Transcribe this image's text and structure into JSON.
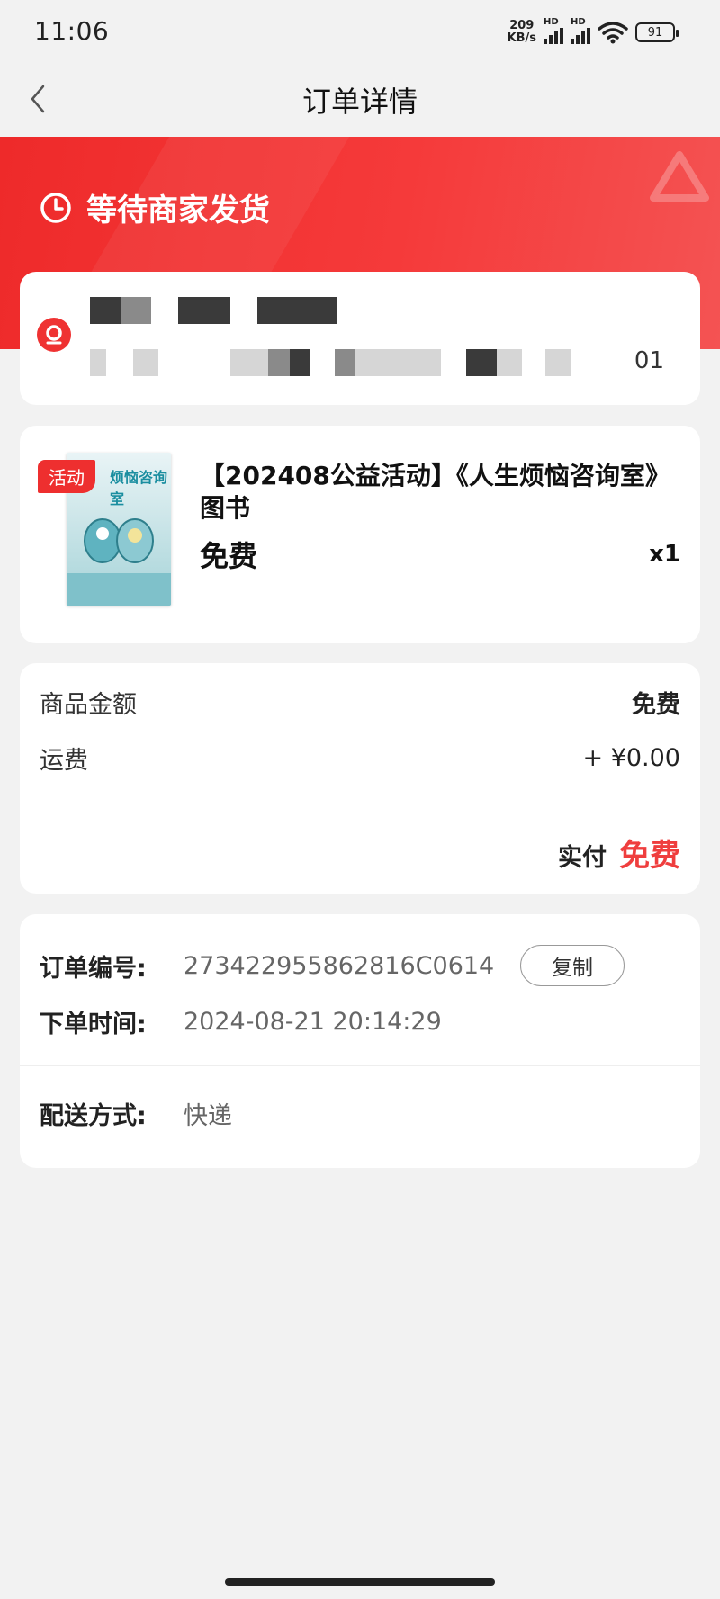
{
  "status_bar": {
    "time": "11:06",
    "net_speed_value": "209",
    "net_speed_unit": "KB/s",
    "signal_label_1": "HD",
    "signal_label_2": "HD",
    "battery": "91"
  },
  "nav": {
    "title": "订单详情",
    "back_icon": "chevron-left-icon"
  },
  "order_status": {
    "text": "等待商家发货",
    "icon": "clock-icon"
  },
  "address": {
    "icon": "location-icon",
    "tail": "01"
  },
  "goods": {
    "tag": "活动",
    "name": "【202408公益活动】《人生烦恼咨询室》图书",
    "cover_title": "烦恼咨询室",
    "price": "免费",
    "quantity": "x1"
  },
  "amounts": {
    "goods_amount_label": "商品金额",
    "goods_amount_value": "免费",
    "shipping_label": "运费",
    "shipping_value": "+ ¥0.00",
    "paid_label": "实付",
    "paid_value": "免费",
    "paid_color": "#ef3e3e"
  },
  "order_info": {
    "order_no_label": "订单编号:",
    "order_no": "273422955862816C0614",
    "copy_label": "复制",
    "time_label": "下单时间:",
    "time": "2024-08-21 20:14:29",
    "delivery_label": "配送方式:",
    "delivery": "快递"
  },
  "theme": {
    "brand_red": "#ee2a2a",
    "background": "#f2f2f2"
  }
}
